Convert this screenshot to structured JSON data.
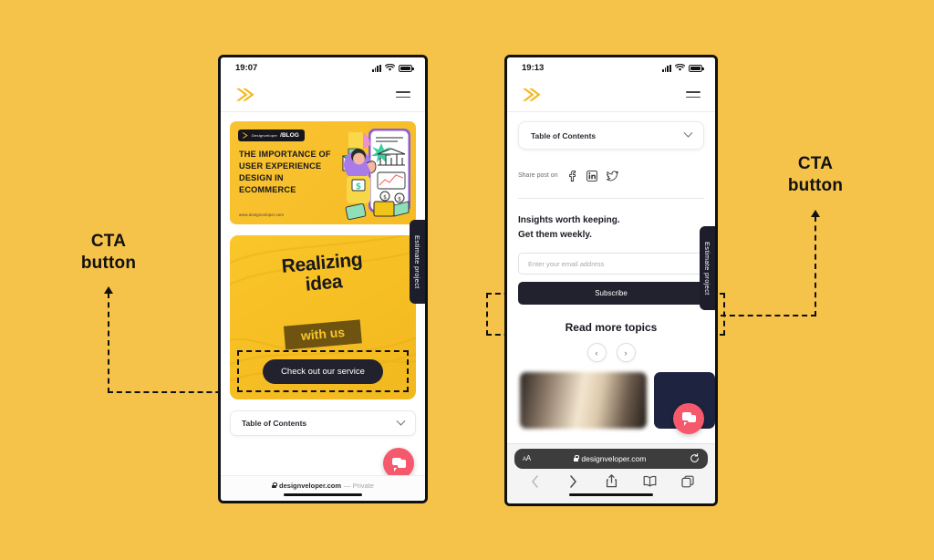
{
  "background_color": "#F5C24A",
  "annotations": [
    {
      "id": "left",
      "line1": "CTA",
      "line2": "button"
    },
    {
      "id": "right",
      "line1": "CTA",
      "line2": "button"
    }
  ],
  "phone_left": {
    "status": {
      "time": "19:07",
      "signal_icon": "cellular-bars-icon",
      "wifi_icon": "wifi-icon",
      "battery_icon": "battery-icon"
    },
    "header": {
      "logo": "designveloper-logo",
      "menu_icon": "hamburger-menu-icon"
    },
    "side_tab": "Estimate project",
    "blog_banner": {
      "badge_brand": "Designveloper",
      "badge_text": "/BLOG",
      "headline": "THE IMPORTANCE OF USER EXPERIENCE DESIGN IN ECOMMERCE",
      "url": "www.designveloper.com"
    },
    "promo_card": {
      "title_line1": "Realizing",
      "title_line2": "idea",
      "ribbon": "with us",
      "cta_label": "Check out our service"
    },
    "toc": {
      "label": "Table of Contents",
      "chevron_icon": "chevron-down-icon"
    },
    "chat_widget_icon": "chat-bubble-icon",
    "safari": {
      "lock_icon": "lock-icon",
      "url": "designveloper.com",
      "mode": "— Private"
    }
  },
  "phone_right": {
    "status": {
      "time": "19:13",
      "signal_icon": "cellular-bars-icon",
      "wifi_icon": "wifi-icon",
      "battery_icon": "battery-icon"
    },
    "header": {
      "logo": "designveloper-logo",
      "menu_icon": "hamburger-menu-icon"
    },
    "side_tab": "Estimate project",
    "toc": {
      "label": "Table of Contents",
      "chevron_icon": "chevron-down-icon"
    },
    "share": {
      "label": "Share post on",
      "icons": [
        "facebook-icon",
        "linkedin-icon",
        "twitter-icon"
      ]
    },
    "newsletter": {
      "line1": "Insights worth keeping.",
      "line2": "Get them weekly.",
      "email_placeholder": "Enter your email address",
      "subscribe_label": "Subscribe"
    },
    "read_more": {
      "title": "Read more topics",
      "prev_icon": "chevron-left-icon",
      "next_icon": "chevron-right-icon"
    },
    "chat_widget_icon": "chat-bubble-icon",
    "safari": {
      "text_size_label": "AA",
      "lock_icon": "lock-icon",
      "url": "designveloper.com",
      "reload_icon": "reload-icon",
      "back_icon": "back-chevron-icon",
      "forward_icon": "forward-chevron-icon",
      "share_icon": "share-icon",
      "bookmarks_icon": "bookmarks-icon",
      "tabs_icon": "tabs-icon"
    }
  }
}
